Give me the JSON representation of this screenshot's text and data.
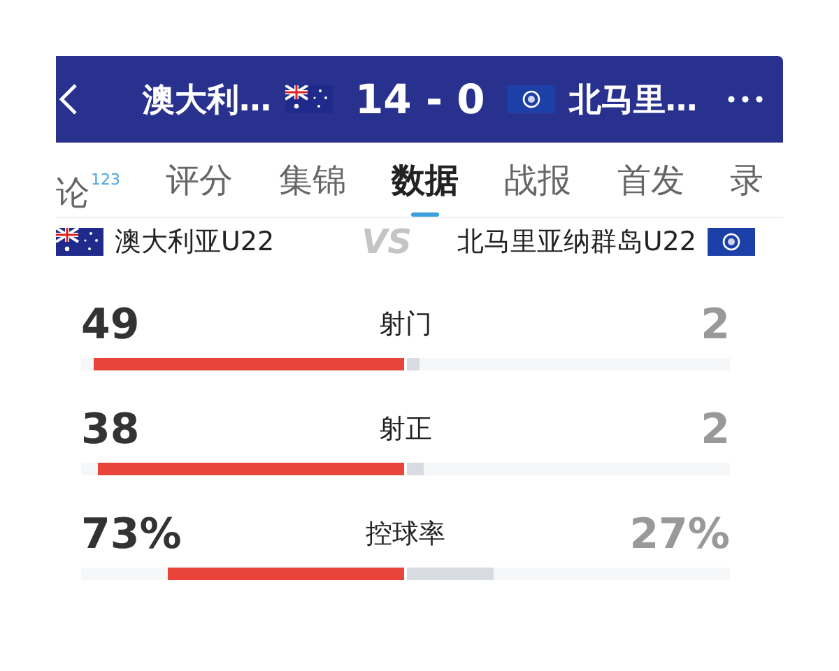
{
  "header": {
    "home_team": "澳大利…",
    "score": "14 - 0",
    "away_team": "北马里…"
  },
  "tabs": [
    {
      "label": "论",
      "badge": "123",
      "selected": false
    },
    {
      "label": "评分",
      "selected": false
    },
    {
      "label": "集锦",
      "selected": false
    },
    {
      "label": "数据",
      "selected": true
    },
    {
      "label": "战报",
      "selected": false
    },
    {
      "label": "首发",
      "selected": false
    },
    {
      "label": "录",
      "selected": false
    }
  ],
  "teams": {
    "home": "澳大利亚U22",
    "vs_mark": "VS",
    "away": "北马里亚纳群岛U22"
  },
  "stats": [
    {
      "name": "射门",
      "home": {
        "value": "49",
        "level": 0.96
      },
      "away": {
        "value": "2",
        "level": 0.04
      }
    },
    {
      "name": "射正",
      "home": {
        "value": "38",
        "level": 0.95
      },
      "away": {
        "value": "2",
        "level": 0.05
      }
    },
    {
      "name": "控球率",
      "home": {
        "value": "73%",
        "level": 0.73
      },
      "away": {
        "value": "27%",
        "level": 0.27
      }
    }
  ]
}
